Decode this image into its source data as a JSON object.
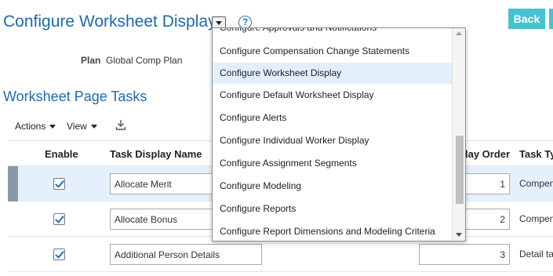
{
  "header": {
    "title": "Configure Worksheet Display",
    "help_glyph": "?",
    "back_label": "Back"
  },
  "plan": {
    "label": "Plan",
    "value": "Global Comp Plan"
  },
  "section": {
    "title": "Worksheet Page Tasks"
  },
  "toolbar": {
    "actions_label": "Actions",
    "view_label": "View",
    "export_icon": "export-icon"
  },
  "table": {
    "columns": {
      "enable": "Enable",
      "task_display_name": "Task Display Name",
      "display_order": "lay Order",
      "task_type": "Task Ty"
    },
    "rows": [
      {
        "enabled": true,
        "name": "Allocate Merit",
        "order": "1",
        "type": "Compen"
      },
      {
        "enabled": true,
        "name": "Allocate Bonus",
        "order": "2",
        "type": "Compen"
      },
      {
        "enabled": true,
        "name": "Additional Person Details",
        "order": "3",
        "type": "Detail ta"
      }
    ]
  },
  "dropdown": {
    "items": [
      "Configure Approvals and Notifications",
      "Configure Compensation Change Statements",
      "Configure Worksheet Display",
      "Configure Default Worksheet Display",
      "Configure Alerts",
      "Configure Individual Worker Display",
      "Configure Assignment Segments",
      "Configure Modeling",
      "Configure Reports",
      "Configure Report Dimensions and Modeling Criteria"
    ],
    "selected": "Configure Worksheet Display"
  },
  "colors": {
    "accent": "#1c6ab0",
    "back_button": "#47c3cf",
    "selected_row": "#e4f0fb",
    "highlight_item": "#e2effa"
  }
}
